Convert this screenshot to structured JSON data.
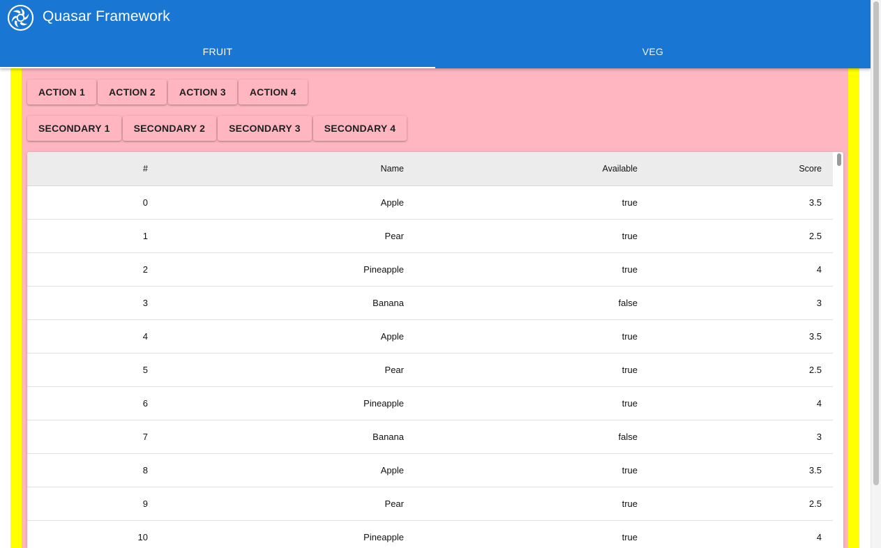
{
  "app": {
    "title": "Quasar Framework",
    "logo_icon": "quasar-logo-icon",
    "brand_color": "#1976d2"
  },
  "tabs": [
    {
      "label": "FRUIT",
      "active": true
    },
    {
      "label": "VEG",
      "active": false
    }
  ],
  "colors": {
    "page_outer": "#ffff00",
    "page_inner": "#ffb6c1",
    "table_header": "#ececec"
  },
  "actions": [
    "ACTION 1",
    "ACTION 2",
    "ACTION 3",
    "ACTION 4"
  ],
  "secondary": [
    "SECONDARY 1",
    "SECONDARY 2",
    "SECONDARY 3",
    "SECONDARY 4"
  ],
  "table": {
    "columns": [
      "#",
      "Name",
      "Available",
      "Score"
    ],
    "rows": [
      [
        "0",
        "Apple",
        "true",
        "3.5"
      ],
      [
        "1",
        "Pear",
        "true",
        "2.5"
      ],
      [
        "2",
        "Pineapple",
        "true",
        "4"
      ],
      [
        "3",
        "Banana",
        "false",
        "3"
      ],
      [
        "4",
        "Apple",
        "true",
        "3.5"
      ],
      [
        "5",
        "Pear",
        "true",
        "2.5"
      ],
      [
        "6",
        "Pineapple",
        "true",
        "4"
      ],
      [
        "7",
        "Banana",
        "false",
        "3"
      ],
      [
        "8",
        "Apple",
        "true",
        "3.5"
      ],
      [
        "9",
        "Pear",
        "true",
        "2.5"
      ],
      [
        "10",
        "Pineapple",
        "true",
        "4"
      ]
    ]
  }
}
